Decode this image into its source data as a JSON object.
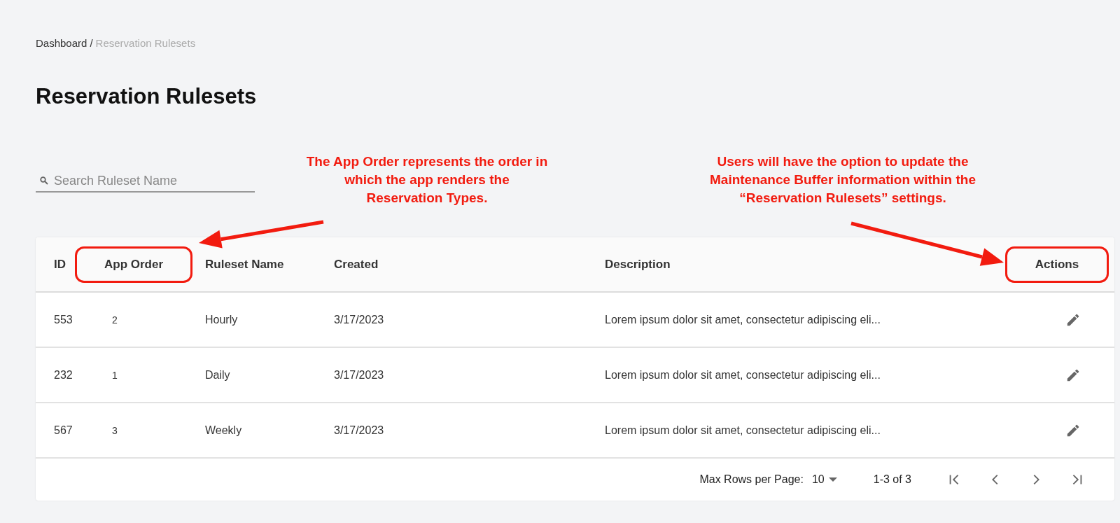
{
  "breadcrumb": {
    "separator": "/",
    "items": [
      {
        "label": "Dashboard",
        "current": false
      },
      {
        "label": "Reservation Rulesets",
        "current": true
      }
    ]
  },
  "title": "Reservation Rulesets",
  "search": {
    "placeholder": "Search Ruleset Name"
  },
  "annotations": [
    {
      "lines": [
        "The App Order represents the order in",
        "which the app renders the",
        "Reservation Types."
      ]
    },
    {
      "lines": [
        "Users will have the option to update the",
        "Maintenance Buffer information within the",
        "“Reservation Rulesets” settings."
      ]
    }
  ],
  "table": {
    "columns": [
      {
        "label": "ID",
        "highlighted": false
      },
      {
        "label": "App Order",
        "highlighted": true
      },
      {
        "label": "Ruleset Name",
        "highlighted": false
      },
      {
        "label": "Created",
        "highlighted": false
      },
      {
        "label": "Description",
        "highlighted": false
      },
      {
        "label": "Actions",
        "highlighted": true
      }
    ],
    "rows": [
      {
        "id": "553",
        "app_order": "2",
        "name": "Hourly",
        "created": "3/17/2023",
        "description": "Lorem ipsum dolor sit amet, consectetur adipiscing eli..."
      },
      {
        "id": "232",
        "app_order": "1",
        "name": "Daily",
        "created": "3/17/2023",
        "description": "Lorem ipsum dolor sit amet, consectetur adipiscing eli..."
      },
      {
        "id": "567",
        "app_order": "3",
        "name": "Weekly",
        "created": "3/17/2023",
        "description": "Lorem ipsum dolor sit amet, consectetur adipiscing eli..."
      }
    ]
  },
  "pagination": {
    "rows_label": "Max Rows per Page:",
    "rows_value": "10",
    "range": "1-3 of 3"
  }
}
